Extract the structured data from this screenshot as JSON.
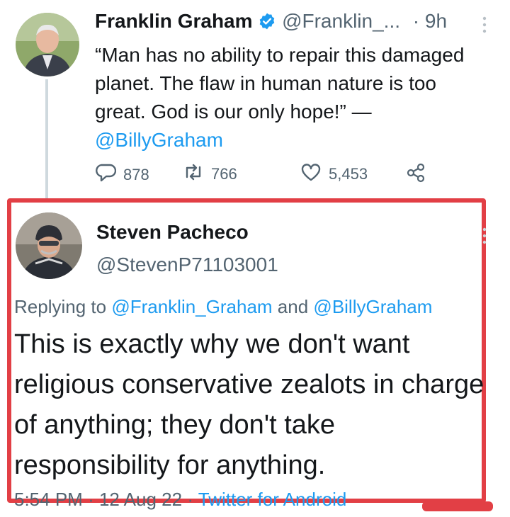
{
  "tweet1": {
    "name": "Franklin Graham",
    "handle": "@Franklin_...",
    "separator": "·",
    "time": "9h",
    "text_part1": "“Man has no ability to repair this damaged planet. The flaw in human nature is too great. God is our only hope!” —",
    "mention": "@BillyGraham",
    "replies": "878",
    "retweets": "766",
    "likes": "5,453",
    "icons": [
      "verified-icon",
      "more-icon",
      "reply-icon",
      "retweet-icon",
      "like-icon",
      "share-icon"
    ]
  },
  "tweet2": {
    "name": "Steven Pacheco",
    "handle": "@StevenP71103001",
    "replying_prefix": "Replying to",
    "replying_mention1": "@Franklin_Graham",
    "replying_and": "and",
    "replying_mention2": "@BillyGraham",
    "text": "This is exactly why we don't want religious conservative zealots in charge of anything; they don't take responsibility for anything.",
    "time": "5:54 PM",
    "separator": "·",
    "date": "12 Aug 22",
    "source": "Twitter for Android",
    "icons": [
      "more-icon"
    ]
  },
  "colors": {
    "link": "#1d9bf0",
    "highlight_border": "#e23f45",
    "meta_text": "#536471",
    "verified": "#1d9bf0"
  }
}
